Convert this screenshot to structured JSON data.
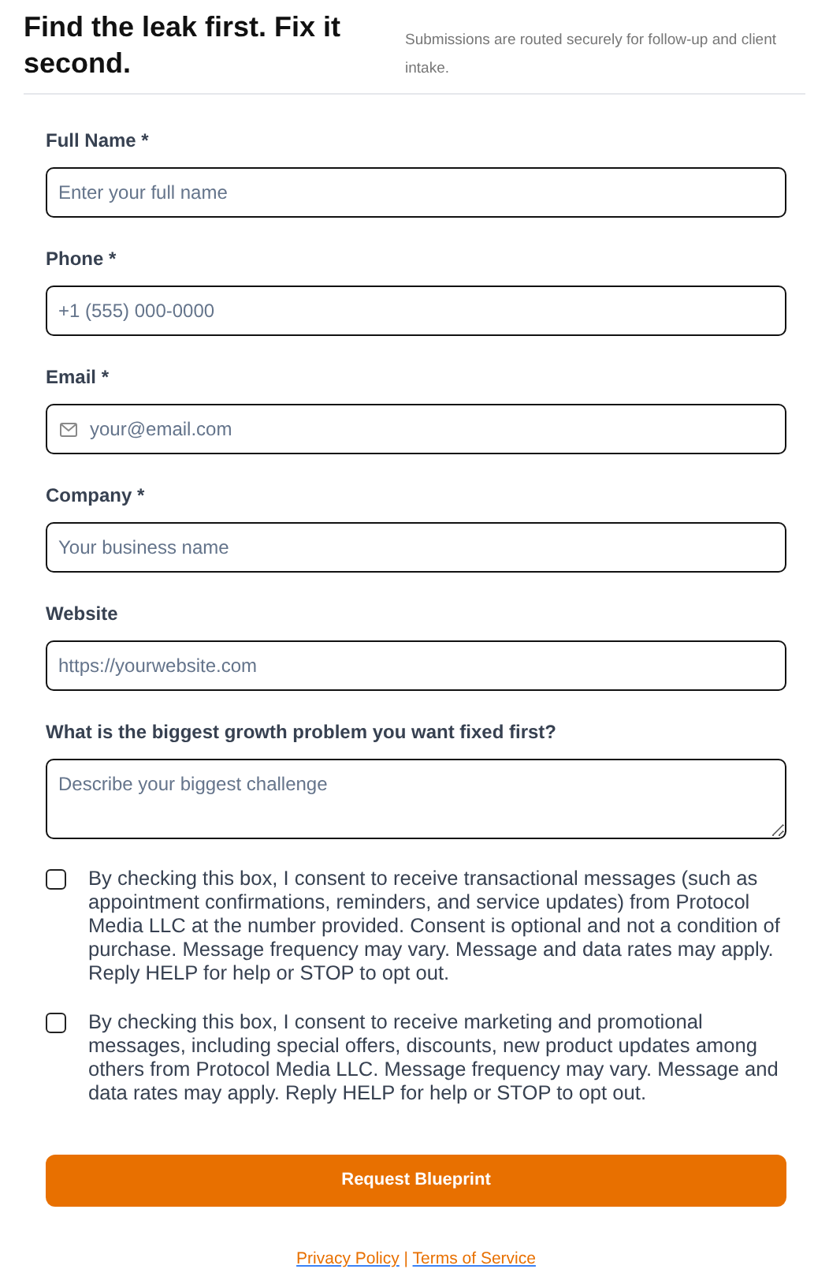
{
  "header": {
    "title": "Find the leak first. Fix it second.",
    "note": "Submissions are routed securely for follow-up and client intake."
  },
  "fields": [
    {
      "label": "Full Name *",
      "kind": "input",
      "placeholder": "Enter your full name"
    },
    {
      "label": "Phone *",
      "kind": "input",
      "placeholder": "+1 (555) 000-0000"
    },
    {
      "label": "Email *",
      "kind": "email",
      "placeholder": "your@email.com"
    },
    {
      "label": "Company *",
      "kind": "input",
      "placeholder": "Your business name"
    },
    {
      "label": "Website",
      "kind": "input",
      "placeholder": "https://yourwebsite.com"
    },
    {
      "label": "What is the biggest growth problem you want fixed first?",
      "kind": "textarea",
      "placeholder": "Describe your biggest challenge"
    }
  ],
  "consents": [
    {
      "checked": false,
      "text": "By checking this box, I consent to receive transactional messages (such as appointment confirmations, reminders, and service updates) from Protocol Media LLC at the number provided. Consent is optional and not a condition of purchase. Message frequency may vary. Message and data rates may apply. Reply HELP for help or STOP to opt out."
    },
    {
      "checked": false,
      "text": "By checking this box, I consent to receive marketing and promotional messages, including special offers, discounts, new product updates among others from Protocol Media LLC. Message frequency may vary. Message and data rates may apply. Reply HELP for help or STOP to opt out."
    }
  ],
  "submit": "Request Blueprint",
  "footer": {
    "links": [
      "Privacy Policy",
      "Terms of Service"
    ],
    "separator": "|"
  }
}
